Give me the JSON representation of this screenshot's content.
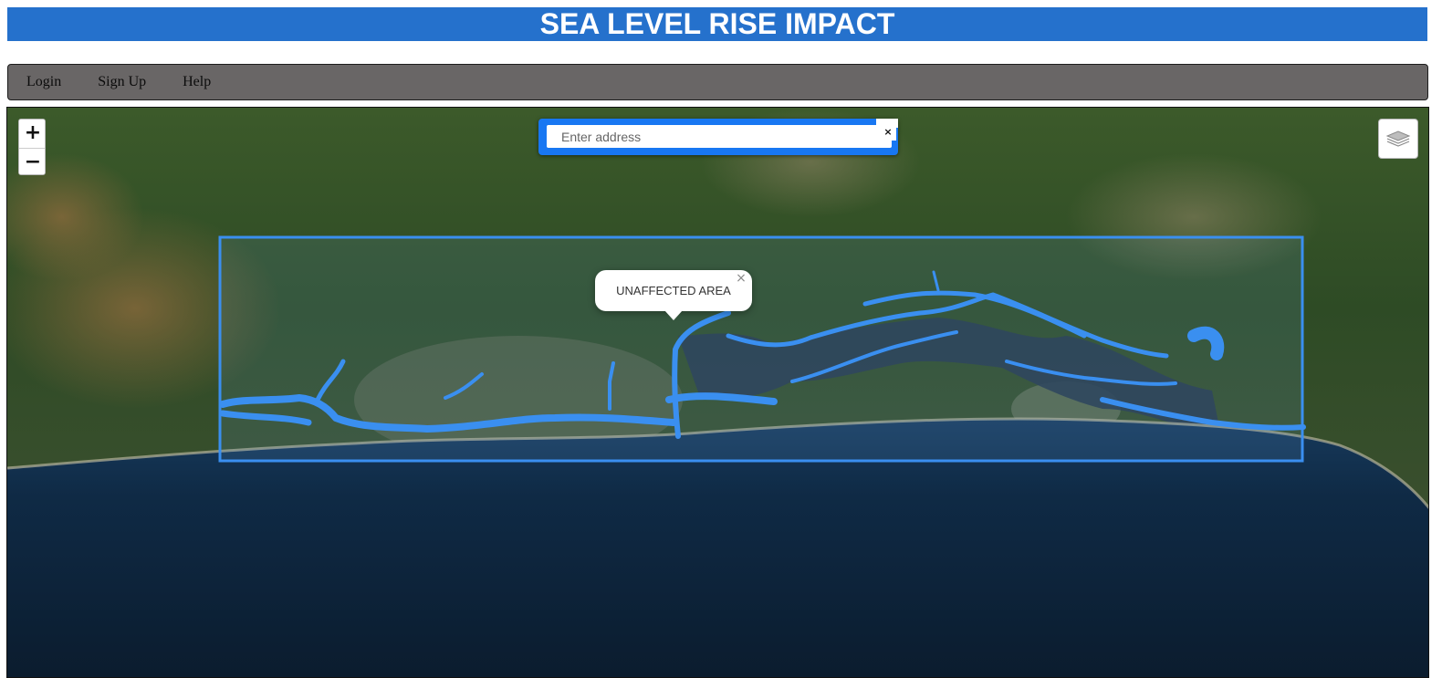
{
  "header": {
    "title": "SEA LEVEL RISE IMPACT"
  },
  "nav": {
    "items": [
      {
        "label": "Login"
      },
      {
        "label": "Sign Up"
      },
      {
        "label": "Help"
      }
    ]
  },
  "map": {
    "controls": {
      "zoom_in": "+",
      "zoom_out": "−"
    },
    "search": {
      "placeholder": "Enter address",
      "clear_label": "×"
    },
    "layers_icon": "layers-icon",
    "popup": {
      "text": "UNAFFECTED AREA",
      "close_label": "×"
    },
    "colors": {
      "flood_overlay": "#3a8ff0",
      "study_area_outline": "#3a8ff0",
      "ocean": "#0e2136",
      "land": "#2f4a22"
    }
  }
}
